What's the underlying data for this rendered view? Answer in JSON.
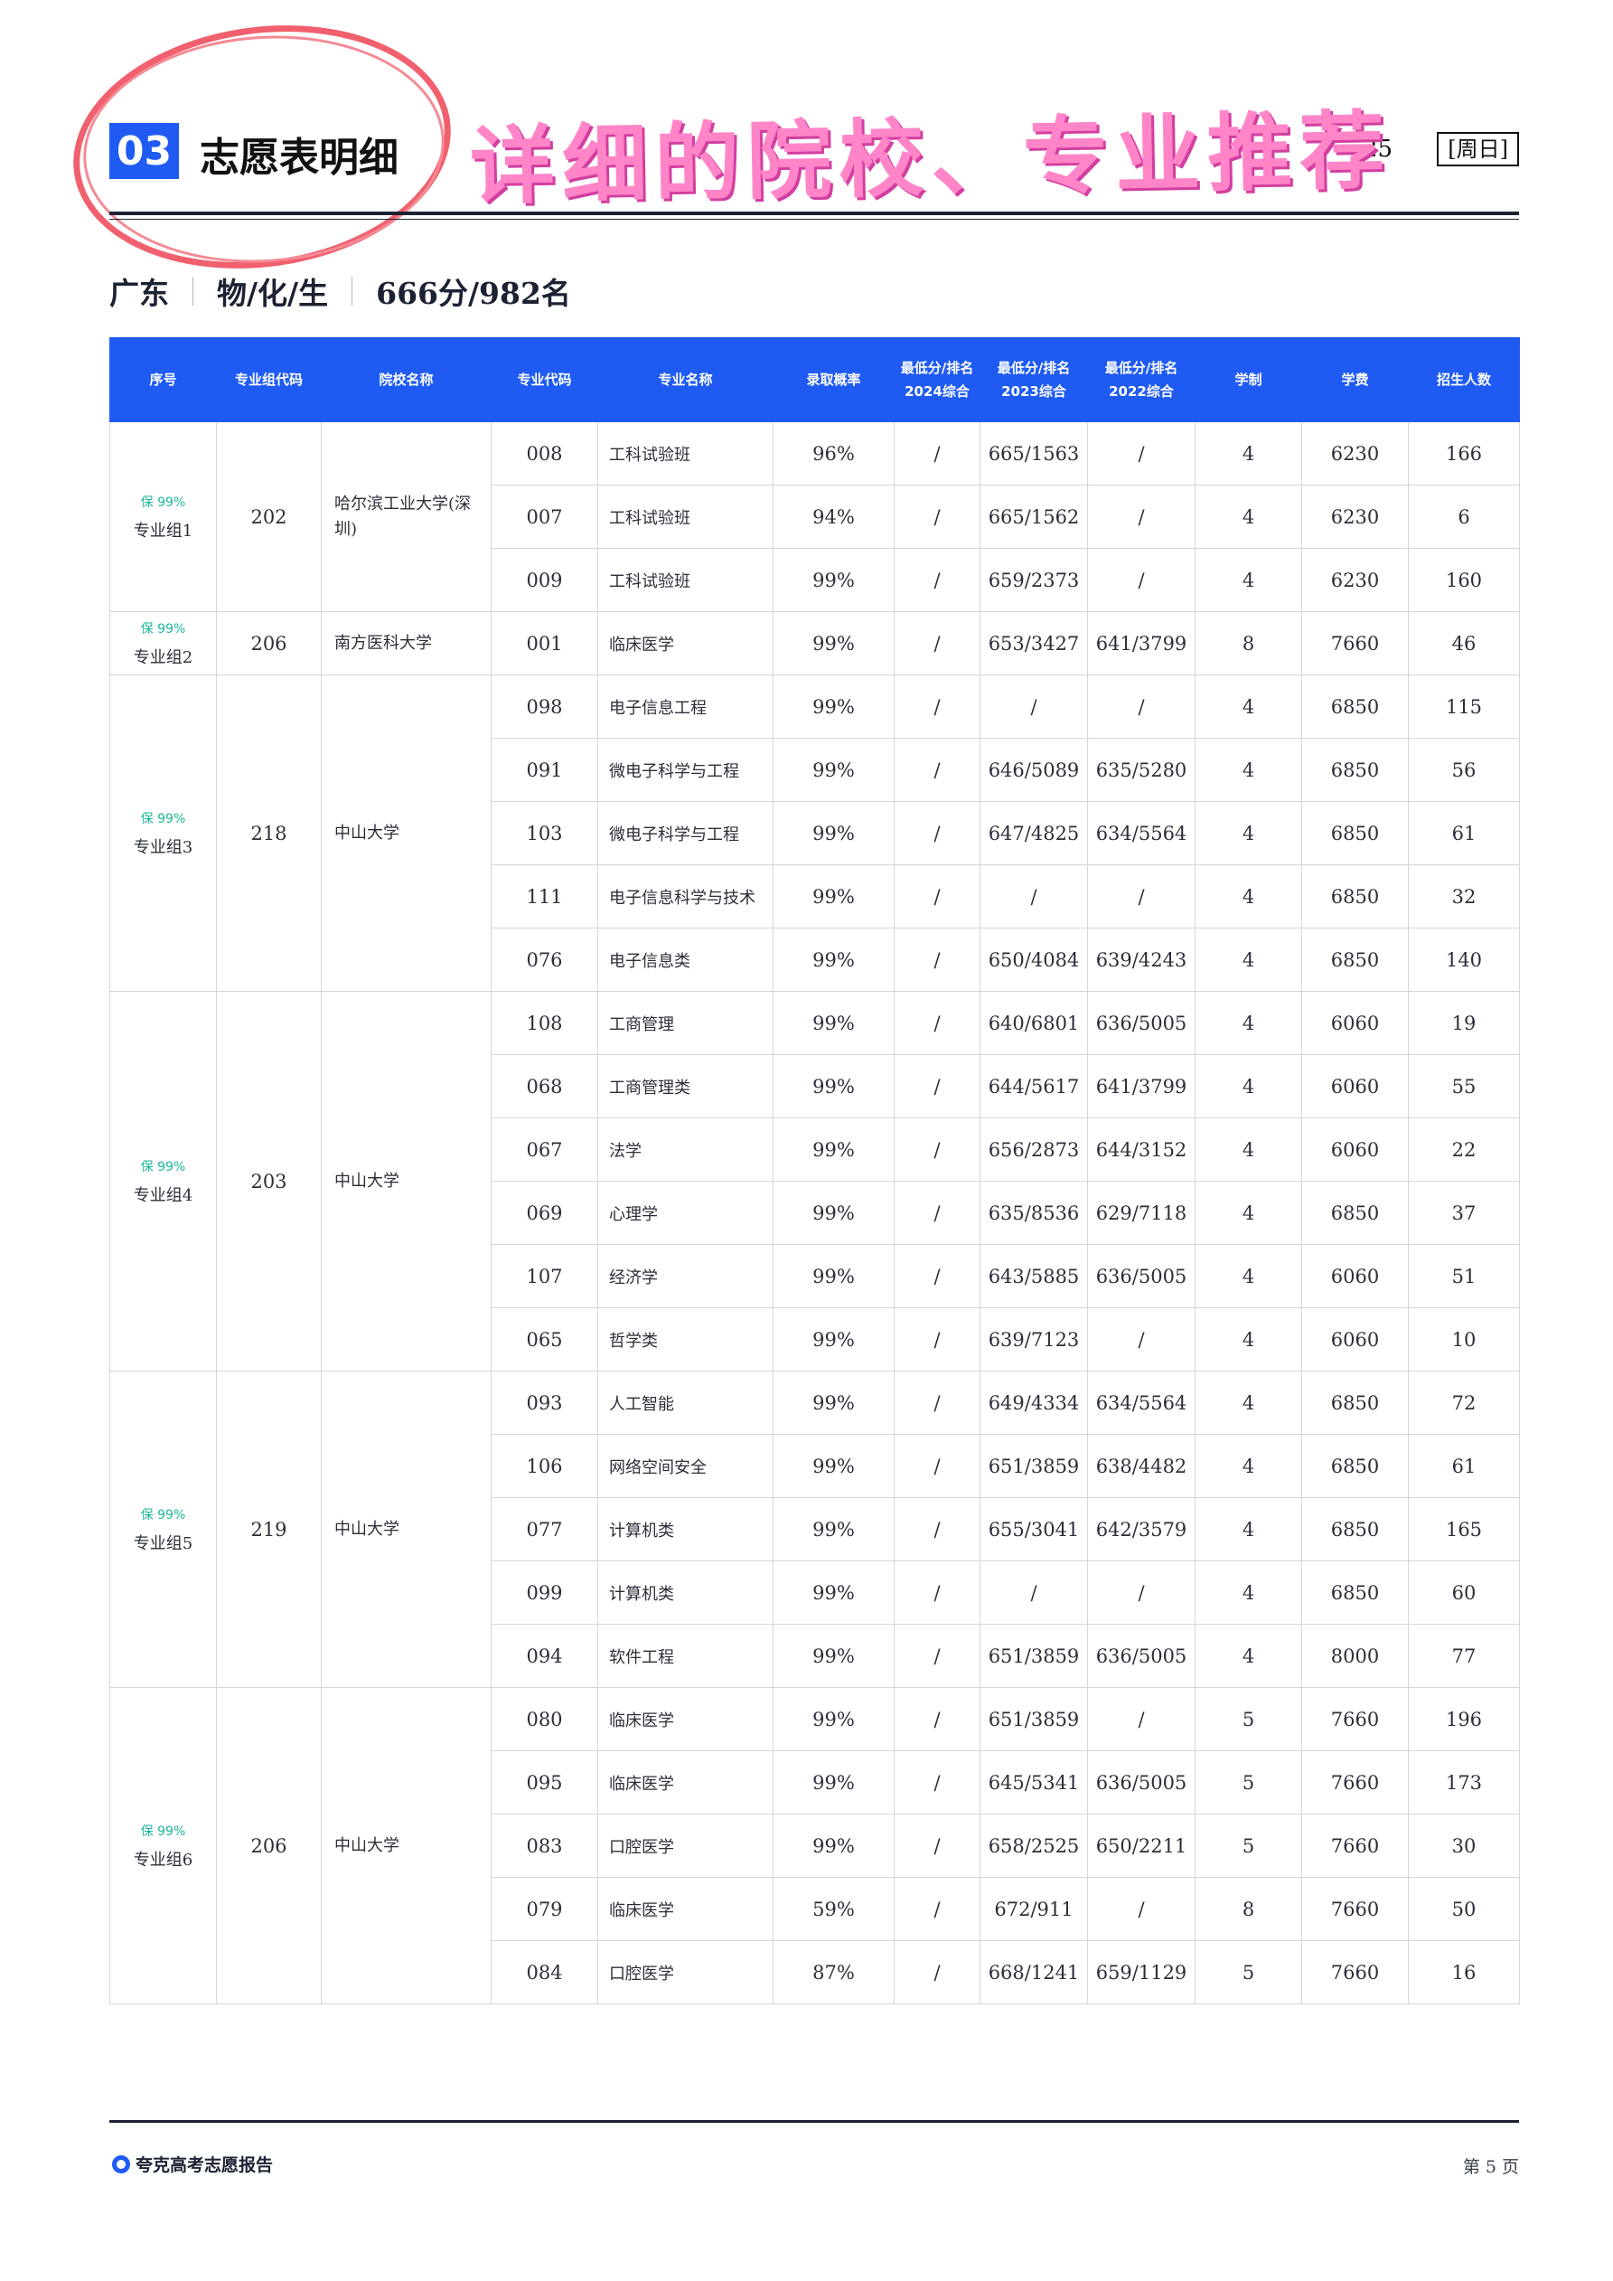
{
  "section": {
    "number": "03",
    "title": "志愿表明细",
    "date": "25",
    "weekday": "[周日]"
  },
  "promo": {
    "text": "详细的院校、专业推荐"
  },
  "subtitle": {
    "province": "广东",
    "subjects": "物/化/生",
    "score_rank": "666分/982名"
  },
  "table": {
    "headers": {
      "seq": "序号",
      "group_code": "专业组代码",
      "school": "院校名称",
      "major_code": "专业代码",
      "major_name": "专业名称",
      "prob": "录取概率",
      "y2024_l1": "最低分/排名",
      "y2024_l2": "2024综合",
      "y2023_l1": "最低分/排名",
      "y2023_l2": "2023综合",
      "y2022_l1": "最低分/排名",
      "y2022_l2": "2022综合",
      "years": "学制",
      "fee": "学费",
      "quota": "招生人数"
    },
    "groups": [
      {
        "badge": "保 99%",
        "label": "专业组1",
        "code": "202",
        "school": "哈尔滨工业大学(深圳)",
        "rows": [
          [
            "008",
            "工科试验班",
            "96%",
            "/",
            "665/1563",
            "/",
            "4",
            "6230",
            "166"
          ],
          [
            "007",
            "工科试验班",
            "94%",
            "/",
            "665/1562",
            "/",
            "4",
            "6230",
            "6"
          ],
          [
            "009",
            "工科试验班",
            "99%",
            "/",
            "659/2373",
            "/",
            "4",
            "6230",
            "160"
          ]
        ]
      },
      {
        "badge": "保 99%",
        "label": "专业组2",
        "code": "206",
        "school": "南方医科大学",
        "rows": [
          [
            "001",
            "临床医学",
            "99%",
            "/",
            "653/3427",
            "641/3799",
            "8",
            "7660",
            "46"
          ]
        ]
      },
      {
        "badge": "保 99%",
        "label": "专业组3",
        "code": "218",
        "school": "中山大学",
        "rows": [
          [
            "098",
            "电子信息工程",
            "99%",
            "/",
            "/",
            "/",
            "4",
            "6850",
            "115"
          ],
          [
            "091",
            "微电子科学与工程",
            "99%",
            "/",
            "646/5089",
            "635/5280",
            "4",
            "6850",
            "56"
          ],
          [
            "103",
            "微电子科学与工程",
            "99%",
            "/",
            "647/4825",
            "634/5564",
            "4",
            "6850",
            "61"
          ],
          [
            "111",
            "电子信息科学与技术",
            "99%",
            "/",
            "/",
            "/",
            "4",
            "6850",
            "32"
          ],
          [
            "076",
            "电子信息类",
            "99%",
            "/",
            "650/4084",
            "639/4243",
            "4",
            "6850",
            "140"
          ]
        ]
      },
      {
        "badge": "保 99%",
        "label": "专业组4",
        "code": "203",
        "school": "中山大学",
        "rows": [
          [
            "108",
            "工商管理",
            "99%",
            "/",
            "640/6801",
            "636/5005",
            "4",
            "6060",
            "19"
          ],
          [
            "068",
            "工商管理类",
            "99%",
            "/",
            "644/5617",
            "641/3799",
            "4",
            "6060",
            "55"
          ],
          [
            "067",
            "法学",
            "99%",
            "/",
            "656/2873",
            "644/3152",
            "4",
            "6060",
            "22"
          ],
          [
            "069",
            "心理学",
            "99%",
            "/",
            "635/8536",
            "629/7118",
            "4",
            "6850",
            "37"
          ],
          [
            "107",
            "经济学",
            "99%",
            "/",
            "643/5885",
            "636/5005",
            "4",
            "6060",
            "51"
          ],
          [
            "065",
            "哲学类",
            "99%",
            "/",
            "639/7123",
            "/",
            "4",
            "6060",
            "10"
          ]
        ]
      },
      {
        "badge": "保 99%",
        "label": "专业组5",
        "code": "219",
        "school": "中山大学",
        "rows": [
          [
            "093",
            "人工智能",
            "99%",
            "/",
            "649/4334",
            "634/5564",
            "4",
            "6850",
            "72"
          ],
          [
            "106",
            "网络空间安全",
            "99%",
            "/",
            "651/3859",
            "638/4482",
            "4",
            "6850",
            "61"
          ],
          [
            "077",
            "计算机类",
            "99%",
            "/",
            "655/3041",
            "642/3579",
            "4",
            "6850",
            "165"
          ],
          [
            "099",
            "计算机类",
            "99%",
            "/",
            "/",
            "/",
            "4",
            "6850",
            "60"
          ],
          [
            "094",
            "软件工程",
            "99%",
            "/",
            "651/3859",
            "636/5005",
            "4",
            "8000",
            "77"
          ]
        ]
      },
      {
        "badge": "保 99%",
        "label": "专业组6",
        "code": "206",
        "school": "中山大学",
        "rows": [
          [
            "080",
            "临床医学",
            "99%",
            "/",
            "651/3859",
            "/",
            "5",
            "7660",
            "196"
          ],
          [
            "095",
            "临床医学",
            "99%",
            "/",
            "645/5341",
            "636/5005",
            "5",
            "7660",
            "173"
          ],
          [
            "083",
            "口腔医学",
            "99%",
            "/",
            "658/2525",
            "650/2211",
            "5",
            "7660",
            "30"
          ],
          [
            "079",
            "临床医学",
            "59%",
            "/",
            "672/911",
            "/",
            "8",
            "7660",
            "50"
          ],
          [
            "084",
            "口腔医学",
            "87%",
            "/",
            "668/1241",
            "659/1129",
            "5",
            "7660",
            "16"
          ]
        ]
      }
    ]
  },
  "footer": {
    "brand": "夸克高考志愿报告",
    "page": "第 5 页"
  },
  "colors": {
    "accent": "#1f5bf2",
    "badge": "#1bb89a",
    "promo": "#ff85c8",
    "circle": "#f0606e"
  }
}
